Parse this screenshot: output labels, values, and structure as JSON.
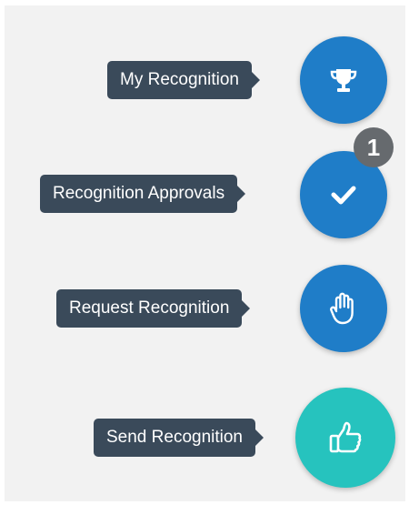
{
  "actions": [
    {
      "id": "my-recognition",
      "label": "My Recognition",
      "icon": "trophy-icon",
      "color": "#1f7dc8"
    },
    {
      "id": "recognition-approvals",
      "label": "Recognition Approvals",
      "icon": "checkmark-icon",
      "color": "#1f7dc8",
      "badge": "1"
    },
    {
      "id": "request-recognition",
      "label": "Request Recognition",
      "icon": "raised-hand-icon",
      "color": "#1f7dc8"
    },
    {
      "id": "send-recognition",
      "label": "Send Recognition",
      "icon": "thumbs-up-icon",
      "color": "#26c3be"
    }
  ],
  "colors": {
    "tooltip_bg": "#3a4a5a",
    "badge_bg": "#666a6e",
    "panel_bg": "#f2f2f2"
  }
}
